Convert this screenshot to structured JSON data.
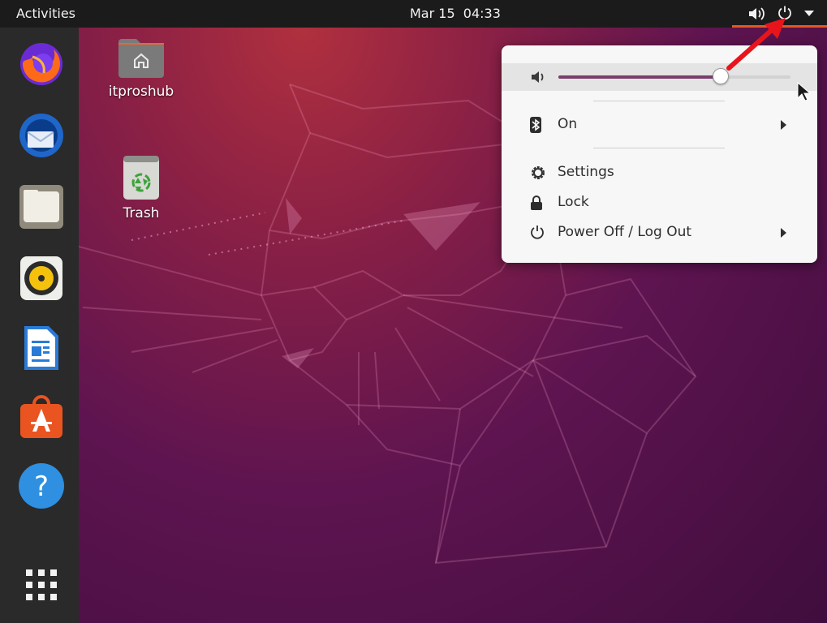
{
  "topbar": {
    "activities": "Activities",
    "clock": "Mar 15  04:33",
    "tray_icons": [
      "speaker-icon",
      "power-icon",
      "dropdown-arrow-icon"
    ]
  },
  "dock": {
    "apps": [
      "firefox-icon",
      "thunderbird-icon",
      "files-icon",
      "rhythmbox-icon",
      "libreoffice-writer-icon",
      "software-center-icon",
      "help-icon"
    ],
    "show_apps": "show-applications-icon"
  },
  "desktop": {
    "icons": [
      {
        "label": "itproshub",
        "icon": "home-folder-icon"
      },
      {
        "label": "Trash",
        "icon": "trash-icon"
      }
    ]
  },
  "menu": {
    "volume_level": 0.7,
    "bluetooth_label": "On",
    "settings_label": "Settings",
    "lock_label": "Lock",
    "power_label": "Power Off / Log Out"
  },
  "colors": {
    "accent": "#e95420",
    "slider_fill": "#7a3e6d",
    "annotation_arrow": "#e8141c"
  }
}
